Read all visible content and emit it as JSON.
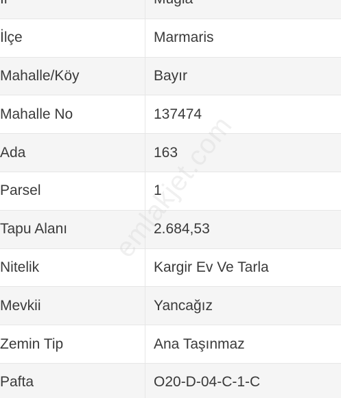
{
  "rows": [
    {
      "label": "İl",
      "value": "Muğla"
    },
    {
      "label": "İlçe",
      "value": "Marmaris"
    },
    {
      "label": "Mahalle/Köy",
      "value": "Bayır"
    },
    {
      "label": "Mahalle No",
      "value": "137474"
    },
    {
      "label": "Ada",
      "value": "163"
    },
    {
      "label": "Parsel",
      "value": "1"
    },
    {
      "label": "Tapu Alanı",
      "value": "2.684,53"
    },
    {
      "label": "Nitelik",
      "value": "Kargir Ev Ve Tarla"
    },
    {
      "label": "Mevkii",
      "value": "Yancağız"
    },
    {
      "label": "Zemin Tip",
      "value": "Ana Taşınmaz"
    },
    {
      "label": "Pafta",
      "value": "O20-D-04-C-1-C"
    }
  ],
  "watermark": "emlakjet.com"
}
